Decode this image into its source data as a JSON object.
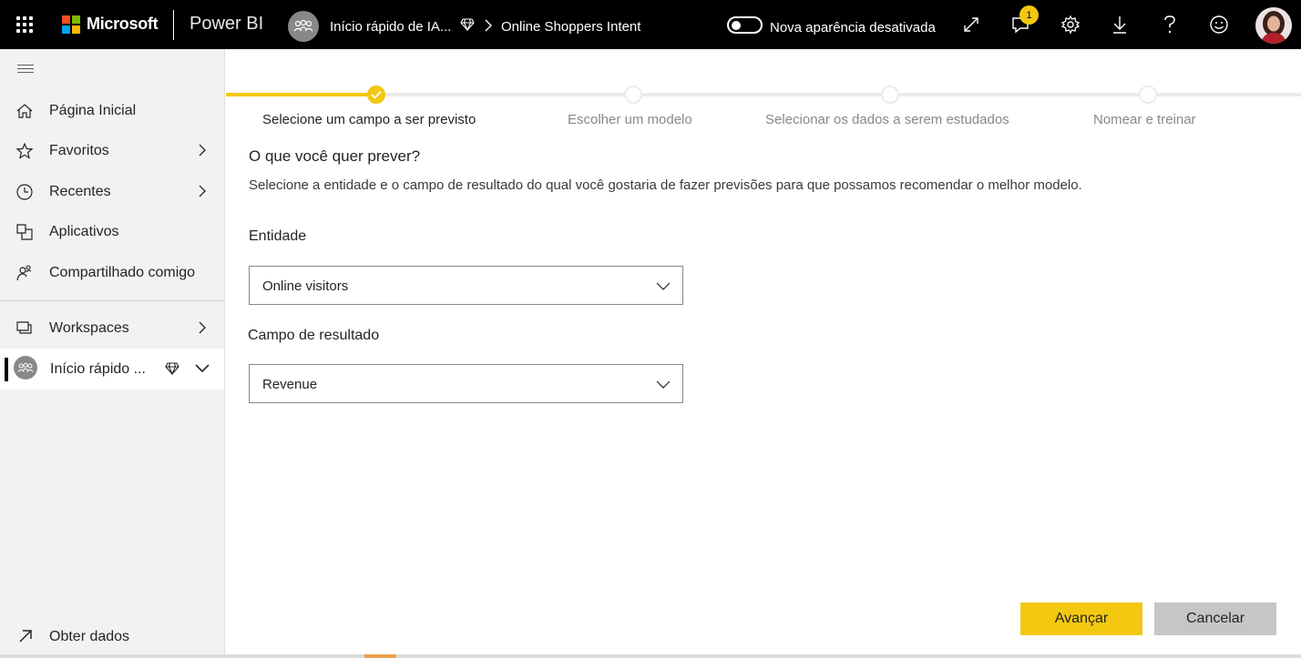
{
  "topbar": {
    "brand": "Microsoft",
    "product": "Power BI",
    "workspace_crumb": "Início rápido de IA...",
    "report_crumb": "Online Shoppers Intent",
    "toggle_label": "Nova aparência desativada",
    "notification_count": "1",
    "icons": [
      "app-launcher-icon",
      "expand-icon",
      "notifications-icon",
      "settings-icon",
      "download-icon",
      "help-icon",
      "feedback-icon"
    ]
  },
  "sidebar": {
    "items": [
      {
        "label": "Página Inicial",
        "icon": "home-icon"
      },
      {
        "label": "Favoritos",
        "icon": "star-icon"
      },
      {
        "label": "Recentes",
        "icon": "clock-icon"
      },
      {
        "label": "Aplicativos",
        "icon": "apps-icon"
      },
      {
        "label": "Compartilhado comigo",
        "icon": "shared-icon"
      },
      {
        "label": "Workspaces",
        "icon": "workspaces-icon"
      }
    ],
    "active_workspace": "Início rápido ...",
    "get_data": "Obter dados"
  },
  "stepper": {
    "steps": [
      {
        "label": "Selecione um campo a ser previsto",
        "state": "done"
      },
      {
        "label": "Escolher um modelo",
        "state": "pending"
      },
      {
        "label": "Selecionar os dados a serem estudados",
        "state": "pending"
      },
      {
        "label": "Nomear e treinar",
        "state": "pending"
      }
    ]
  },
  "form": {
    "title": "O que você quer prever?",
    "description": "Selecione a entidade e o campo de resultado do qual você gostaria de fazer previsões para que possamos recomendar o melhor modelo.",
    "entity_label": "Entidade",
    "entity_value": "Online visitors",
    "outcome_label": "Campo de resultado",
    "outcome_value": "Revenue"
  },
  "buttons": {
    "next": "Avançar",
    "cancel": "Cancelar"
  },
  "colors": {
    "accent": "#f2c811",
    "topbar": "#000000",
    "sidebar": "#f3f2f1"
  }
}
